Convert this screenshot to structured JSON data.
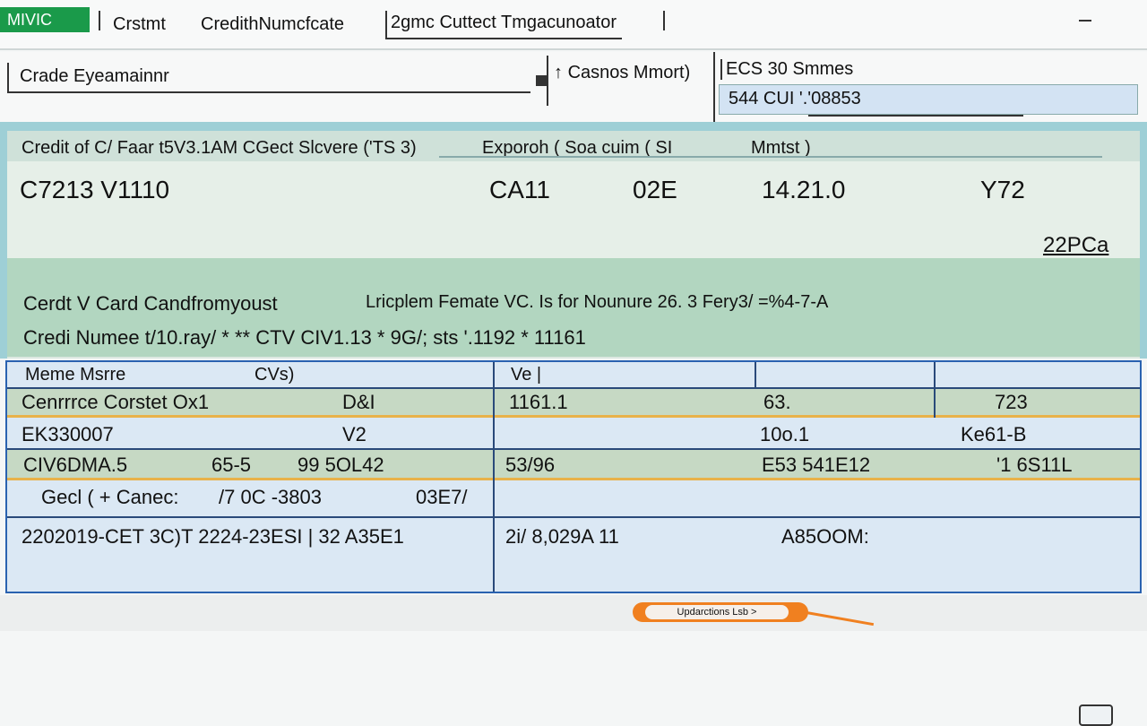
{
  "topbar": {
    "logo": "MIVIC",
    "items": [
      "Crstmt",
      "CredithNumcfcate"
    ],
    "active_tab": "2gmc Cuttect Tmgacunoator"
  },
  "row2": {
    "card_name_value": "Crade Eyeamainnr",
    "cashed_label": "Casnos Mmort)",
    "ecs_label": "ECS 30 Smmes",
    "ecs_input_value": "544 CUI '.'08853"
  },
  "panel1": {
    "labels": [
      "Credit of C/ Faar t5V3.1AM CGect Slcvere ('TS 3)",
      "Exporoh ( Soa cuim ( SI",
      "Mmtst )"
    ],
    "values": [
      "C7213 V1110",
      "CA11",
      "02E",
      "14.21.0",
      "Y72"
    ],
    "sum": "22PCa",
    "line1": "Cerdt V Card Candfromyoust",
    "line1_right": "Lricplem Femate VC.  Is for Nounure 26.  3  Fery3/ =%4-7-A",
    "line2": "Credi Numee  t/10.ray/ * ** CTV CIV1.13 * 9G/; sts  '.1192 * 11161"
  },
  "table": {
    "header": [
      "Meme Msrre",
      "CVs)",
      "Ve |"
    ],
    "rows": [
      [
        "Cenrrrce Corstet  Ox1",
        "D&I",
        "1161.1",
        "63.",
        "723"
      ],
      [
        "EK330007",
        "V2",
        "",
        "10o.1",
        "Ke61-B"
      ],
      [
        "CIV6DMA.5",
        "65-5",
        "99 5OL42",
        "53/96",
        "E53 541E12",
        "'1 6S11L"
      ],
      [
        "Gecl ( + Canec:",
        "/7 0C -3803",
        "03E7/"
      ],
      [
        "2202019-CET 3C)T 2224-23ESI | 32 A35E1",
        "2i/ 8,029A 11",
        "A85OOM:"
      ]
    ]
  },
  "bottom": {
    "button_label": "Updarctions Lsb >"
  }
}
